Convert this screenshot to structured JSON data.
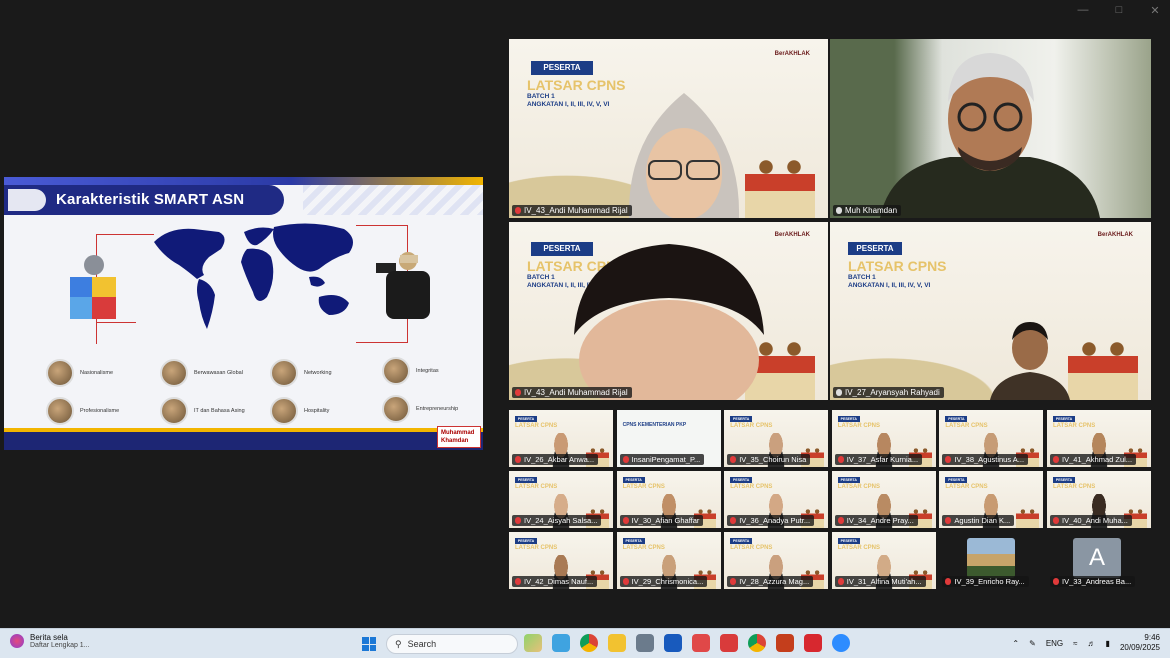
{
  "slide": {
    "title": "Karakteristik SMART ASN",
    "logo_text": "Muhammad Khamdan",
    "traits": [
      "Nasionalisme",
      "Berwawasan Global",
      "Networking",
      "Integritas",
      "Profesionalisme",
      "IT dan Bahasa Asing",
      "Hospitality",
      "Entrepreneurship"
    ]
  },
  "tile_slide": {
    "peserta": "PESERTA",
    "latsar": "LATSAR CPNS",
    "batch": "BATCH 1",
    "angkatan": "ANGKATAN I, II, III, IV, V, VI",
    "logos": "BerAKHLAK"
  },
  "large_tiles": [
    {
      "name": "IV_43_Andi Muhammad Rijal"
    },
    {
      "name": "Muh Khamdan"
    },
    {
      "name": "IV_43_Andi Muhammad Rijal"
    },
    {
      "name": "IV_27_Aryansyah Rahyadi"
    }
  ],
  "small_tiles": [
    "IV_26_Akbar Anwa...",
    "InsaniPengamat_P...",
    "IV_35_Choirun Nisa",
    "IV_37_Asfar Kurnia...",
    "IV_38_Agustinus A...",
    "IV_41_Akhmad Zul...",
    "IV_24_Aisyah Salsa...",
    "IV_30_Afian Ghaffar",
    "IV_36_Anadya Putr...",
    "IV_34_Andre Pray...",
    "Agustin Dian K...",
    "IV_40_Andi Muha...",
    "IV_42_Dimas Nauf...",
    "IV_29_Chrismonica...",
    "IV_28_Azzura Mag...",
    "IV_31_Alfina Muti'ah...",
    "IV_39_Enricho Ray...",
    "IV_33_Andreas Ba..."
  ],
  "insani_caption": "CPNS KEMENTERIAN PKP",
  "avatar_letter": "A",
  "taskbar": {
    "weather_title": "Berita sela",
    "weather_sub": "Daftar Lengkap 1...",
    "search_placeholder": "Search",
    "lang": "ENG",
    "time": "9:46",
    "date": "20/09/2025"
  },
  "colors": {
    "highlight": "#7be58c",
    "slide_navy": "#1f2a84",
    "accent_gold": "#f2b500"
  }
}
